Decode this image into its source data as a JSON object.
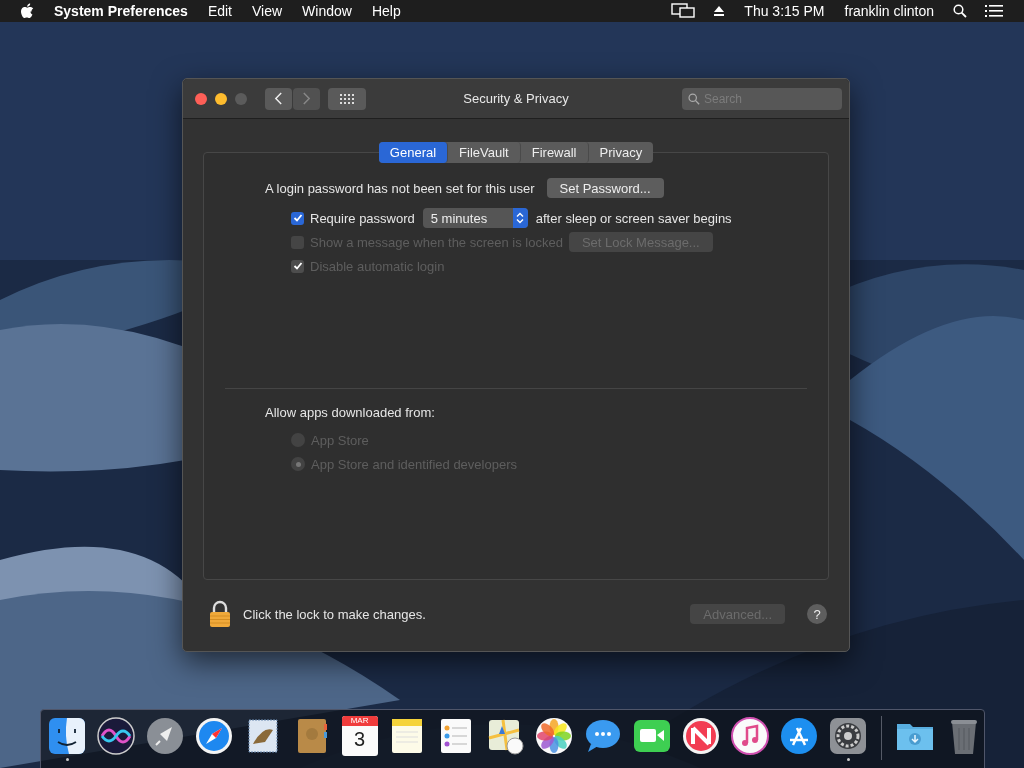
{
  "menubar": {
    "app_name": "System Preferences",
    "menus": [
      "Edit",
      "View",
      "Window",
      "Help"
    ],
    "clock": "Thu 3:15 PM",
    "user": "franklin clinton"
  },
  "window": {
    "title": "Security & Privacy",
    "search": {
      "placeholder": "Search"
    },
    "traffic_lights": [
      {
        "color": "#fe5f57"
      },
      {
        "color": "#febc2e"
      },
      {
        "color": "#5b5b5b"
      }
    ],
    "nav": [
      {
        "kind": "back",
        "disabled": false
      },
      {
        "kind": "forward",
        "disabled": true
      }
    ]
  },
  "tabs": [
    {
      "label": "General",
      "selected": true
    },
    {
      "label": "FileVault",
      "selected": false
    },
    {
      "label": "Firewall",
      "selected": false
    },
    {
      "label": "Privacy",
      "selected": false
    }
  ],
  "general": {
    "password_message": "A login password has not been set for this user",
    "set_password_button": "Set Password...",
    "require_password": {
      "label": "Require password",
      "checked": true,
      "disabled": false,
      "interval": "5 minutes",
      "suffix": "after sleep or screen saver begins"
    },
    "lock_message": {
      "label": "Show a message when the screen is locked",
      "checked": false,
      "disabled": true,
      "button": "Set Lock Message..."
    },
    "auto_login": {
      "label": "Disable automatic login",
      "checked": true,
      "disabled": true
    }
  },
  "allow_apps": {
    "label": "Allow apps downloaded from:",
    "options": [
      {
        "label": "App Store",
        "selected": false,
        "disabled": true
      },
      {
        "label": "App Store and identified developers",
        "selected": true,
        "disabled": true
      }
    ]
  },
  "footer": {
    "lock_text": "Click the lock to make changes.",
    "advanced_button": {
      "label": "Advanced...",
      "disabled": true
    },
    "help": "?"
  },
  "dock": [
    {
      "kind": "finder",
      "running": true
    },
    {
      "kind": "siri",
      "running": false
    },
    {
      "kind": "launchpad",
      "running": false
    },
    {
      "kind": "safari",
      "running": false
    },
    {
      "kind": "mail",
      "running": false
    },
    {
      "kind": "contacts",
      "running": false
    },
    {
      "kind": "calendar",
      "running": false,
      "month": "MAR",
      "day": "3"
    },
    {
      "kind": "notes",
      "running": false
    },
    {
      "kind": "reminders",
      "running": false
    },
    {
      "kind": "maps",
      "running": false
    },
    {
      "kind": "photos",
      "running": false
    },
    {
      "kind": "messages",
      "running": false
    },
    {
      "kind": "facetime",
      "running": false
    },
    {
      "kind": "news",
      "running": false
    },
    {
      "kind": "music",
      "running": false
    },
    {
      "kind": "appstore",
      "running": false
    },
    {
      "kind": "settings",
      "running": true
    },
    {
      "kind": "separator"
    },
    {
      "kind": "downloads",
      "running": false
    },
    {
      "kind": "trash",
      "running": false
    }
  ]
}
